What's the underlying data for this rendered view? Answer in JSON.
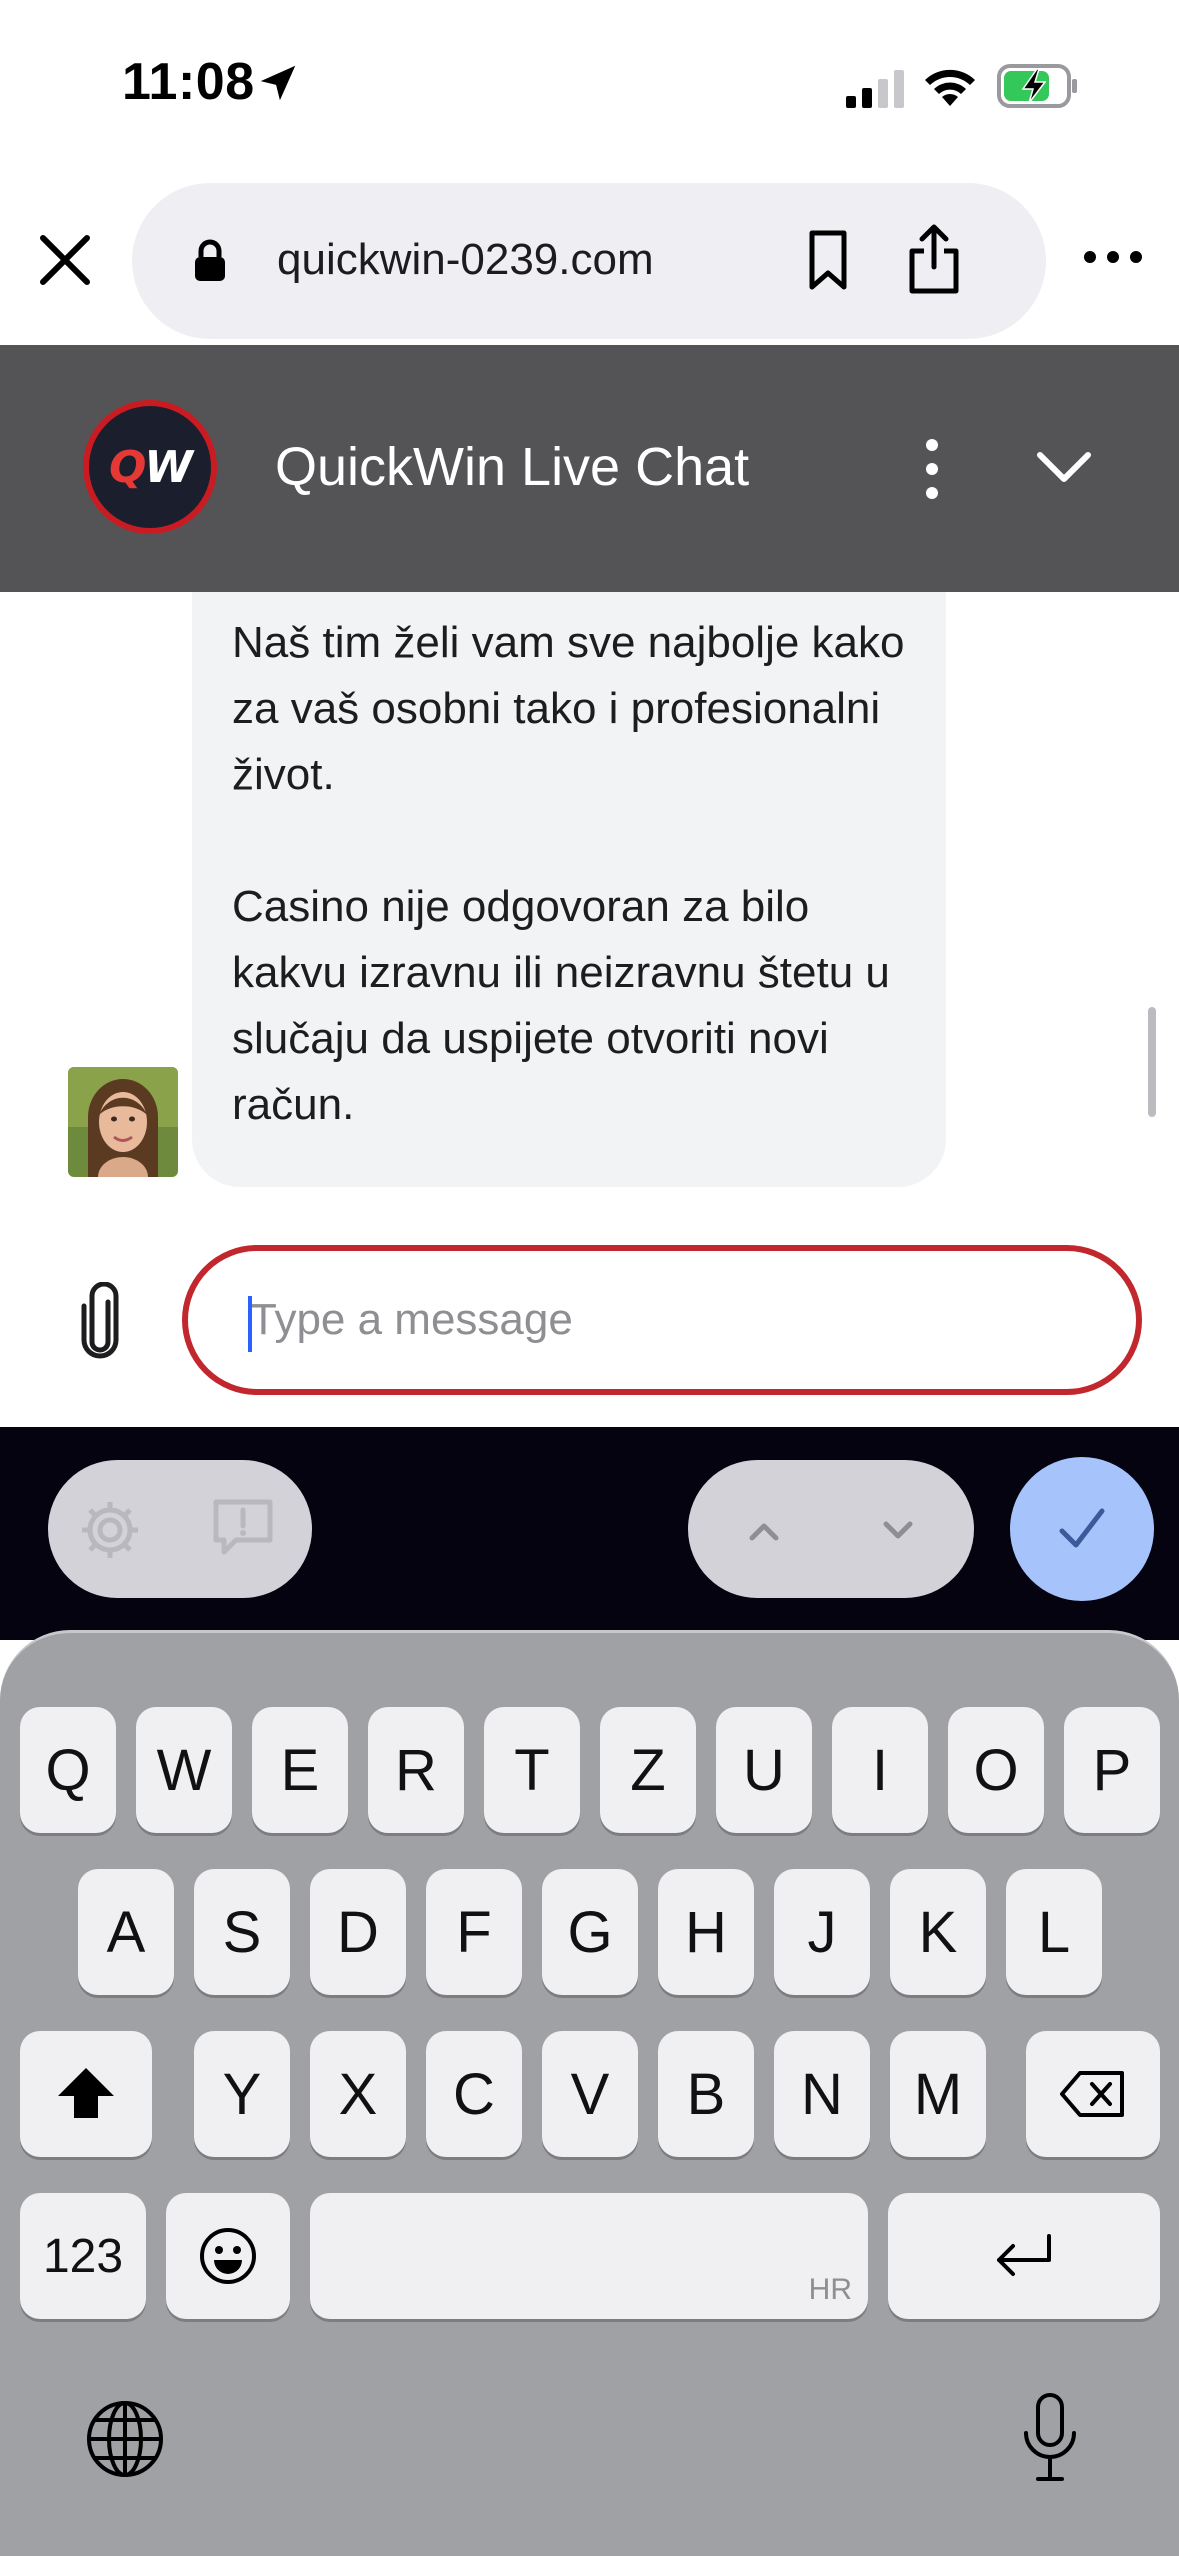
{
  "status_bar": {
    "time": "11:08",
    "icons": [
      "location-arrow-icon",
      "cellular-signal-icon",
      "wifi-icon",
      "battery-charging-icon"
    ]
  },
  "browser": {
    "url": "quickwin-0239.com",
    "icons": [
      "close-icon",
      "lock-icon",
      "bookmark-icon",
      "share-icon",
      "more-icon"
    ]
  },
  "chat_header": {
    "logo_text": "QW",
    "title": "QuickWin Live Chat",
    "icons": [
      "more-vertical-icon",
      "chevron-down-icon"
    ]
  },
  "chat": {
    "messages": [
      {
        "sender": "agent",
        "paragraphs": [
          "Naš tim želi vam sve najbolje kako za vaš osobni tako i profesionalni život.",
          "Casino nije odgovoran za bilo kakvu izravnu ili neizravnu štetu u slučaju da uspijete otvoriti novi račun."
        ]
      }
    ]
  },
  "composer": {
    "placeholder": "Type a message",
    "value": ""
  },
  "keyboard": {
    "rows": [
      [
        "Q",
        "W",
        "E",
        "R",
        "T",
        "Z",
        "U",
        "I",
        "O",
        "P"
      ],
      [
        "A",
        "S",
        "D",
        "F",
        "G",
        "H",
        "J",
        "K",
        "L"
      ],
      [
        "Y",
        "X",
        "C",
        "V",
        "B",
        "N",
        "M"
      ]
    ],
    "numbers_key": "123",
    "space_hint": "HR"
  },
  "colors": {
    "header_bg": "#545457",
    "brand_red": "#c1272d",
    "keyboard_bg": "#a0a1a5",
    "accessory_bg": "#050310",
    "done_button": "#a6c4fb"
  }
}
